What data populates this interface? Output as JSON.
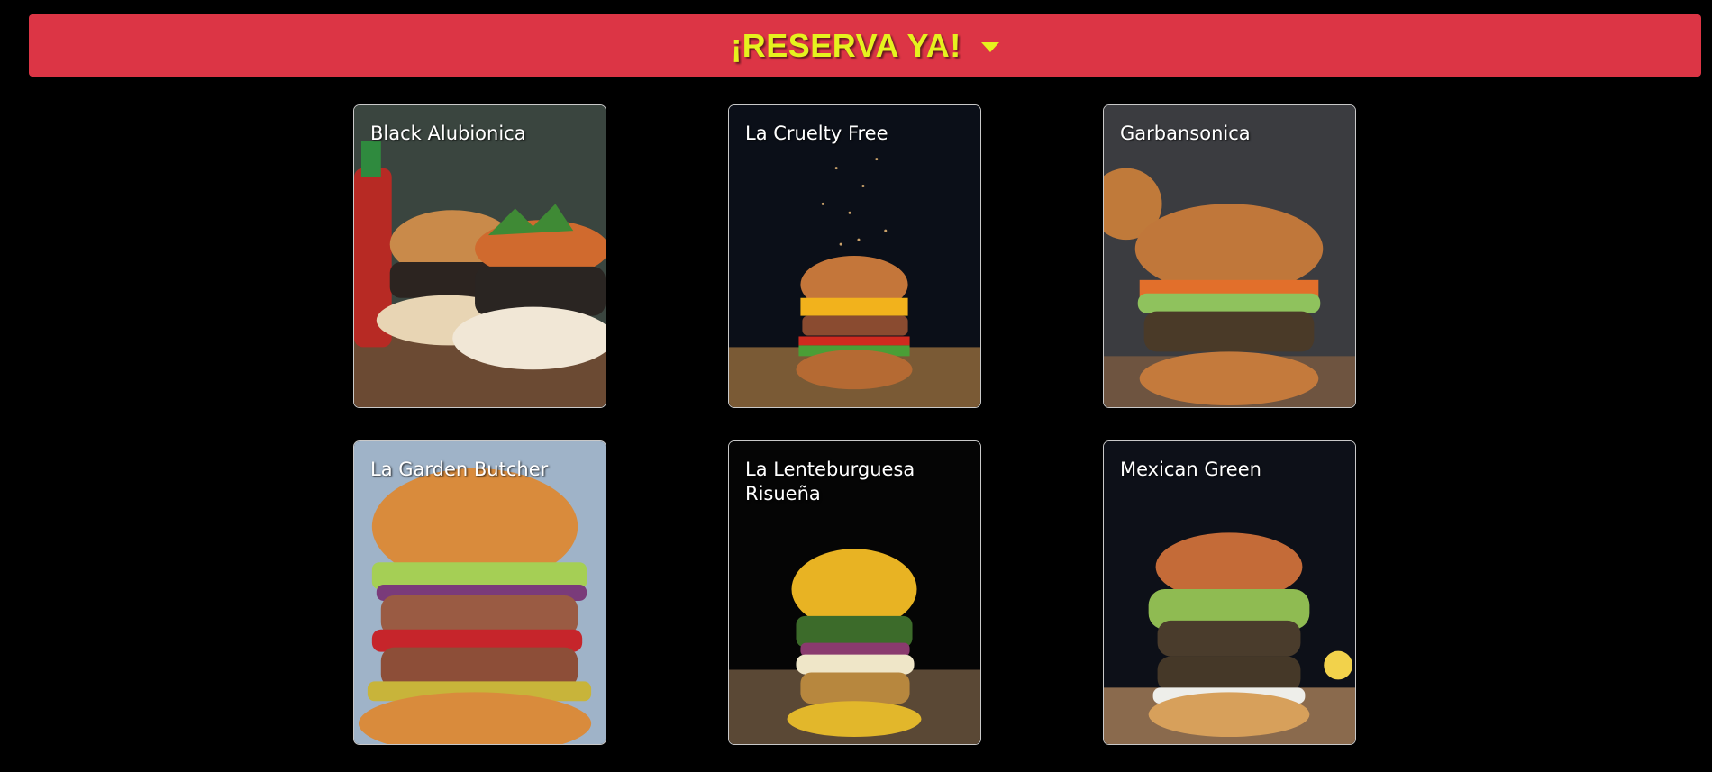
{
  "banner": {
    "label": "¡RESERVA YA!",
    "icon": "chevron-down-icon",
    "bg_color": "#dc3545",
    "text_color": "#e6f21e"
  },
  "menu": {
    "items": [
      {
        "title": "Black Alubionica"
      },
      {
        "title": "La Cruelty Free"
      },
      {
        "title": "Garbansonica"
      },
      {
        "title": "La Garden Butcher"
      },
      {
        "title": "La Lenteburguesa Risueña"
      },
      {
        "title": "Mexican Green"
      }
    ]
  }
}
